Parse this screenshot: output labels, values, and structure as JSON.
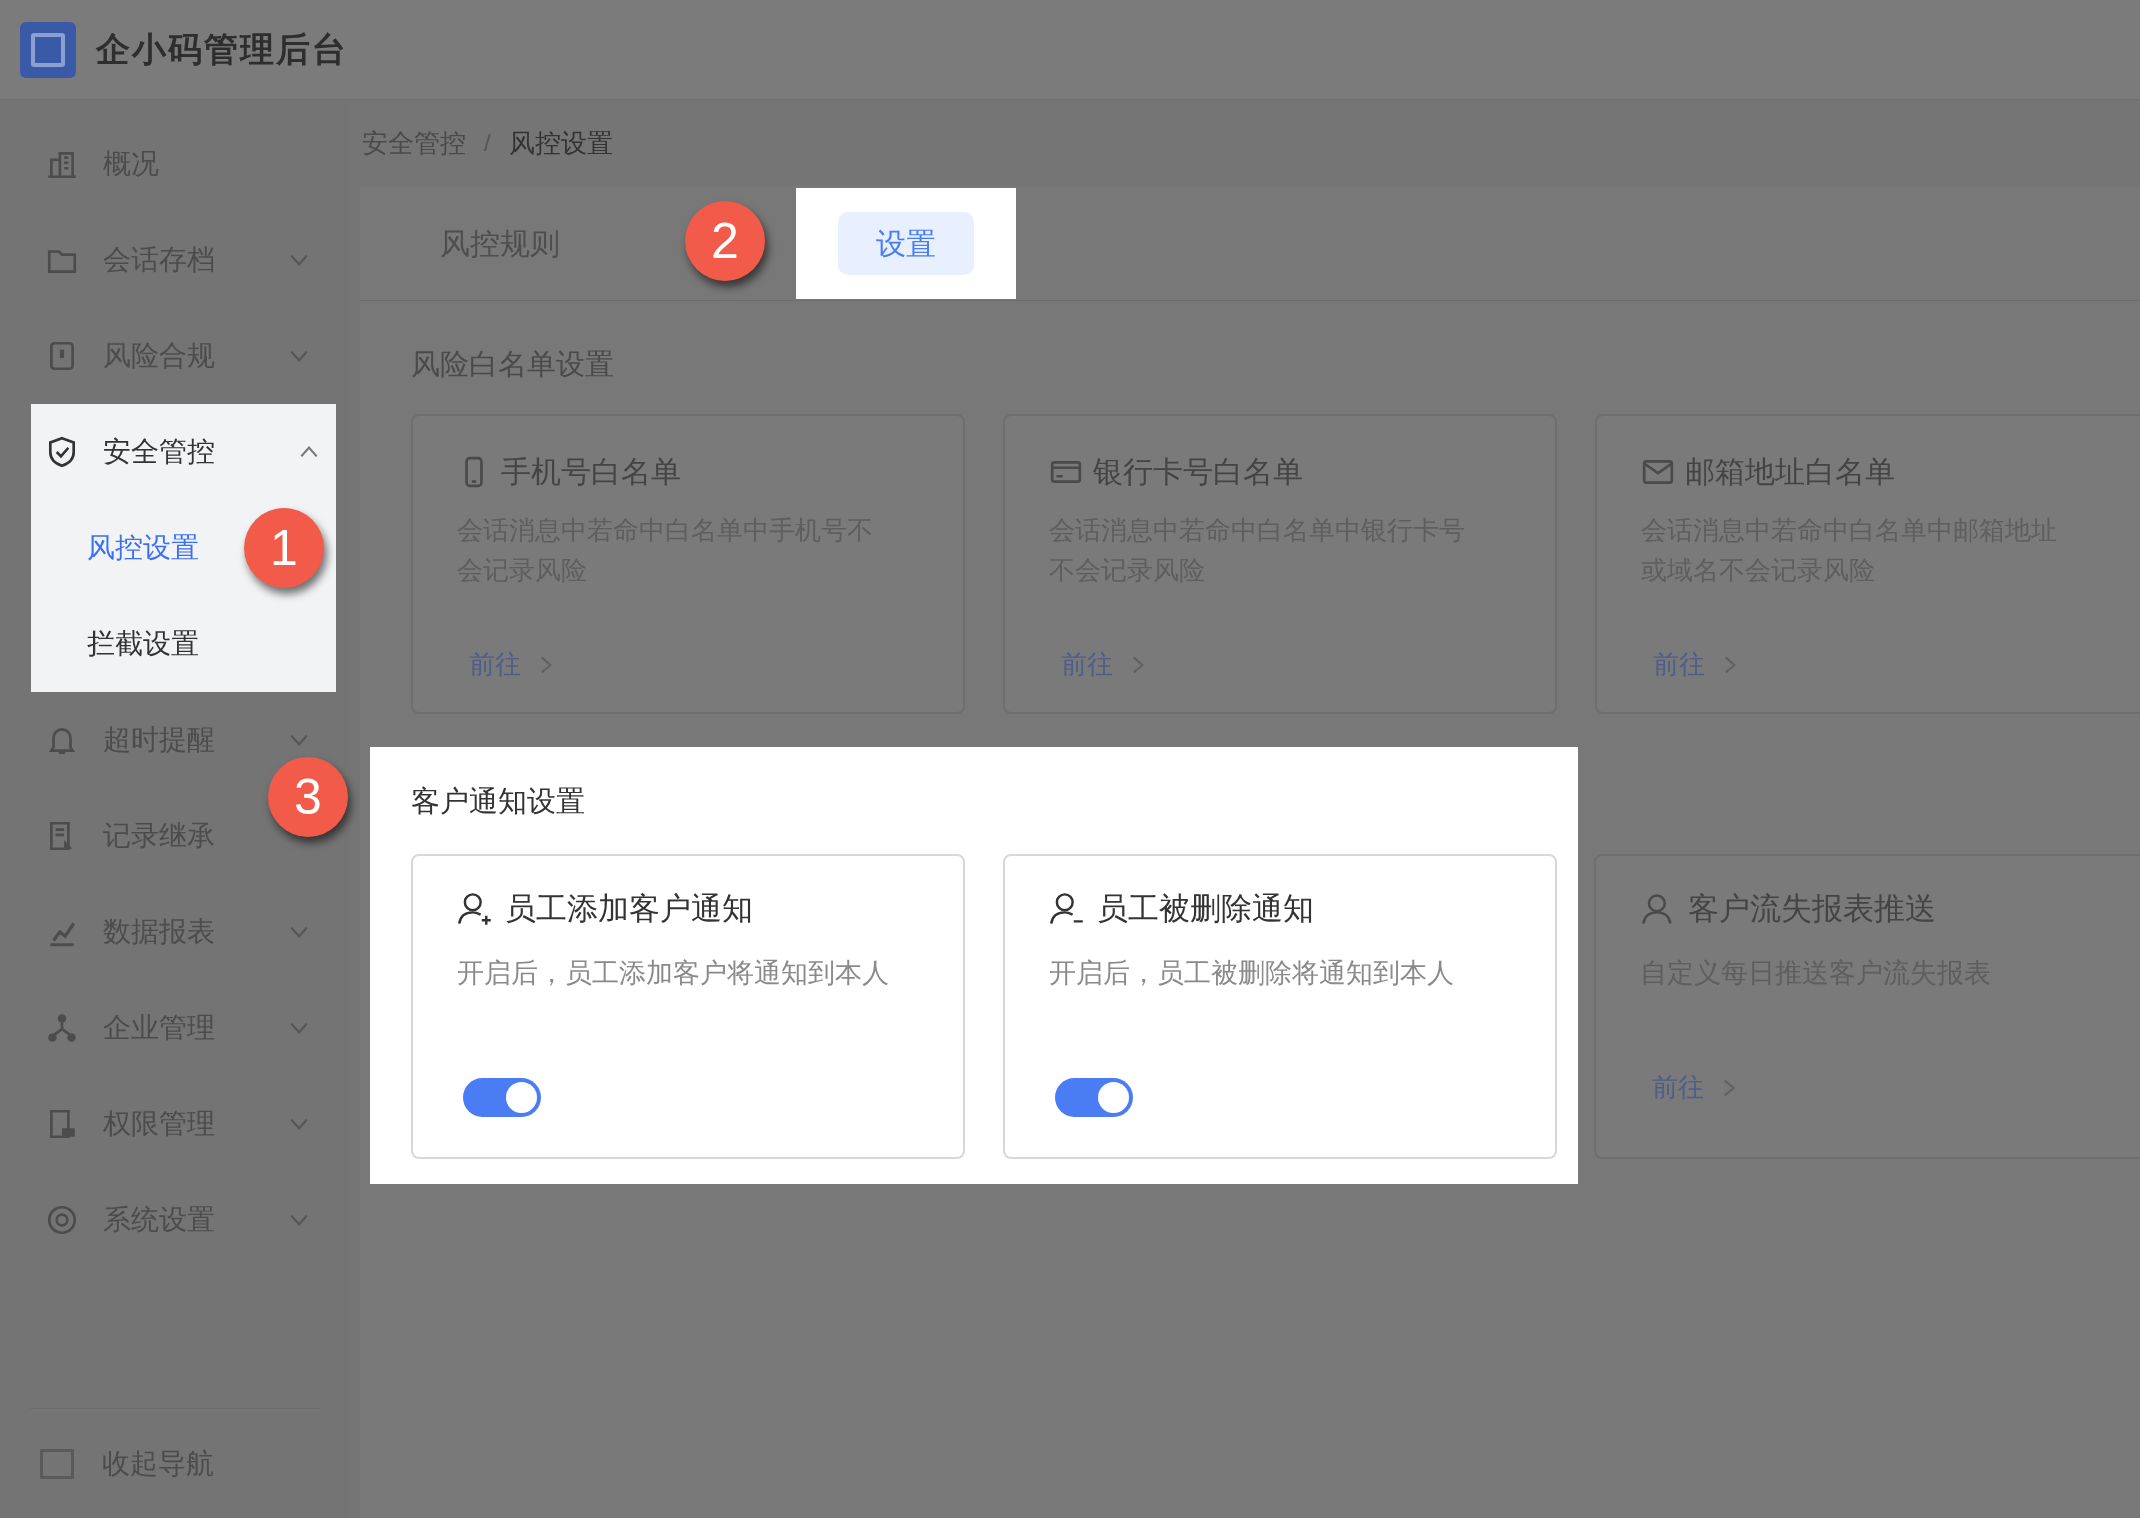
{
  "app": {
    "title": "企小码管理后台"
  },
  "sidebar": {
    "items": [
      {
        "label": "概况",
        "kind": "link"
      },
      {
        "label": "会话存档",
        "kind": "group",
        "expanded": false
      },
      {
        "label": "风险合规",
        "kind": "group",
        "expanded": false
      },
      {
        "label": "安全管控",
        "kind": "group",
        "expanded": true,
        "highlighted": true,
        "children": [
          {
            "label": "风控设置",
            "selected": true,
            "callout": "1"
          },
          {
            "label": "拦截设置",
            "selected": false
          }
        ]
      },
      {
        "label": "超时提醒",
        "kind": "group",
        "expanded": false
      },
      {
        "label": "记录继承",
        "kind": "link"
      },
      {
        "label": "数据报表",
        "kind": "group",
        "expanded": false
      },
      {
        "label": "企业管理",
        "kind": "group",
        "expanded": false
      },
      {
        "label": "权限管理",
        "kind": "group",
        "expanded": false
      },
      {
        "label": "系统设置",
        "kind": "group",
        "expanded": false
      }
    ],
    "collapse": "收起导航"
  },
  "breadcrumb": {
    "items": [
      "安全管控",
      "风控设置"
    ],
    "separator": "/"
  },
  "tabs": [
    {
      "label": "风控规则",
      "selected": false,
      "highlighted": false
    },
    {
      "label": "设置",
      "selected": true,
      "highlighted": true,
      "callout": "2"
    }
  ],
  "whitelist": {
    "title": "风险白名单设置",
    "cards": [
      {
        "title": "手机号白名单",
        "description": "会话消息中若命中白名单中手机号不会记录风险",
        "link": "前往"
      },
      {
        "title": "银行卡号白名单",
        "description": "会话消息中若命中白名单中银行卡号不会记录风险",
        "link": "前往"
      },
      {
        "title": "邮箱地址白名单",
        "description": "会话消息中若命中白名单中邮箱地址或域名不会记录风险",
        "link": "前往"
      }
    ]
  },
  "notifications": {
    "title": "客户通知设置",
    "highlighted": true,
    "callout": "3",
    "cards": [
      {
        "kind": "toggle",
        "title": "员工添加客户通知",
        "description": "开启后，员工添加客户将通知到本人",
        "on": true,
        "highlighted": true
      },
      {
        "kind": "toggle",
        "title": "员工被删除通知",
        "description": "开启后，员工被删除将通知到本人",
        "on": true,
        "highlighted": true
      },
      {
        "kind": "link",
        "title": "客户流失报表推送",
        "description": "自定义每日推送客户流失报表",
        "link": "前往",
        "highlighted": false
      }
    ]
  }
}
